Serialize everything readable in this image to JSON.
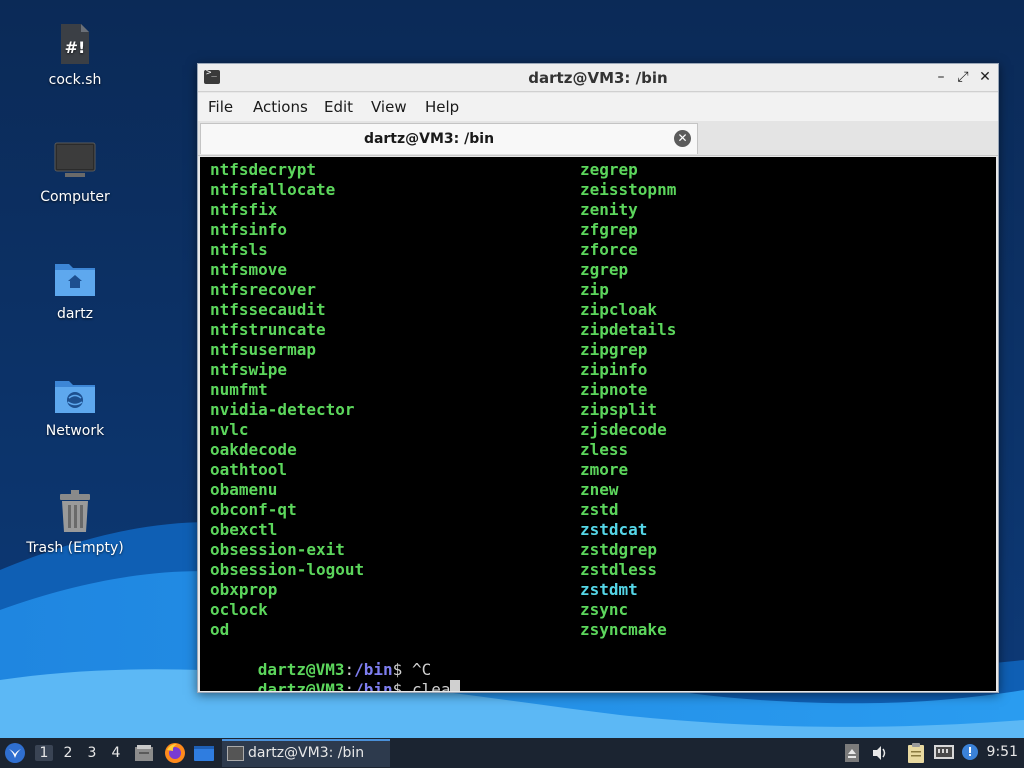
{
  "desktop": {
    "icons": [
      {
        "label": "cock.sh",
        "icon": "script-file-icon"
      },
      {
        "label": "Computer",
        "icon": "computer-icon"
      },
      {
        "label": "dartz",
        "icon": "home-folder-icon"
      },
      {
        "label": "Network",
        "icon": "network-folder-icon"
      },
      {
        "label": "Trash (Empty)",
        "icon": "trash-icon"
      }
    ]
  },
  "window": {
    "title": "dartz@VM3: /bin",
    "buttons": {
      "minimize": "–",
      "maximize": "⤢",
      "close": "✕"
    },
    "menu": [
      "File",
      "Actions",
      "Edit",
      "View",
      "Help"
    ],
    "tab": {
      "label": "dartz@VM3: /bin",
      "close": "✕"
    }
  },
  "terminal": {
    "left_column": [
      "ntfsdecrypt",
      "ntfsfallocate",
      "ntfsfix",
      "ntfsinfo",
      "ntfsls",
      "ntfsmove",
      "ntfsrecover",
      "ntfssecaudit",
      "ntfstruncate",
      "ntfsusermap",
      "ntfswipe",
      "numfmt",
      "nvidia-detector",
      "nvlc",
      "oakdecode",
      "oathtool",
      "obamenu",
      "obconf-qt",
      "obexctl",
      "obsession-exit",
      "obsession-logout",
      "obxprop",
      "oclock",
      "od"
    ],
    "right_column": [
      "zegrep",
      "zeisstopnm",
      "zenity",
      "zfgrep",
      "zforce",
      "zgrep",
      "zip",
      "zipcloak",
      "zipdetails",
      "zipgrep",
      "zipinfo",
      "zipnote",
      "zipsplit",
      "zjsdecode",
      "zless",
      "zmore",
      "znew",
      "zstd",
      "zstdcat",
      "zstdgrep",
      "zstdless",
      "zstdmt",
      "zsync",
      "zsyncmake"
    ],
    "cyan_entries": [
      "zstdcat",
      "zstdmt"
    ],
    "prompts": [
      {
        "user": "dartz@VM3",
        "sep": ":",
        "path": "/bin",
        "symbol": "$ ",
        "text": "^C"
      },
      {
        "user": "dartz@VM3",
        "sep": ":",
        "path": "/bin",
        "symbol": "$ ",
        "text": "clea"
      }
    ]
  },
  "taskbar": {
    "workspaces": [
      "1",
      "2",
      "3",
      "4"
    ],
    "active_workspace": "1",
    "task": {
      "label": "dartz@VM3: /bin",
      "icon": "terminal-icon"
    },
    "tray_icons": [
      "eject-icon",
      "volume-icon",
      "clipboard-icon",
      "network-wired-icon",
      "notification-icon"
    ],
    "clock": "9:51"
  },
  "colors": {
    "terminal_green": "#5cd65c",
    "terminal_cyan": "#55d6e8",
    "prompt_path": "#7e7ef0",
    "taskbar_bg": "#1b2431"
  }
}
